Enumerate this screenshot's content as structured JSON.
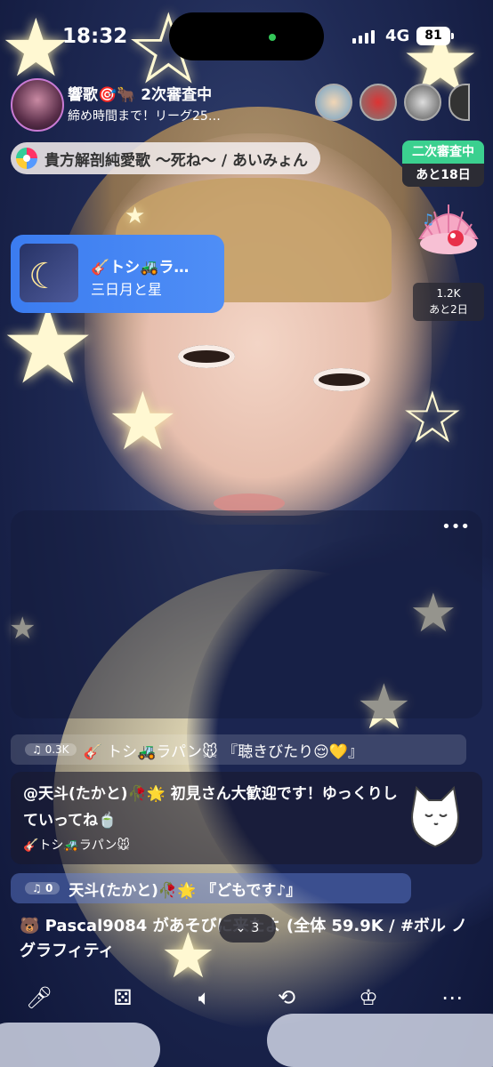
{
  "status_bar": {
    "time": "18:32",
    "network": "4G",
    "battery": "81"
  },
  "host": {
    "name": "響歌",
    "name_emoji": "🎯🐂",
    "stage": "2次審査中",
    "subtitle": "締め時間まで！リーグ25…"
  },
  "song_request": "貴方解剖純愛歌 〜死ね〜 / あいみょん",
  "review_badge": {
    "top": "二次審査中",
    "bottom": "あと18日"
  },
  "gift_event": {
    "count": "1.2K",
    "remaining": "あと2日"
  },
  "now_playing": {
    "title": "🎸トシ🚜ラ…",
    "subtitle": "三日月と星"
  },
  "chat": {
    "faded": {
      "count": "0.3K",
      "text": "🎸 トシ🚜ラパン🐭 『聴きびたり😌💛』"
    },
    "main": {
      "text": "@天斗(たかと)🥀🌟 初見さん大歓迎です！ゆっくりしていってね🍵",
      "author": "🎸トシ🚜ラパン🐭"
    },
    "reply": {
      "count": "0",
      "text": "天斗(たかと)🥀🌟 『どもです♪』"
    },
    "join": "🐻 Pascal9084 があそびに来たよ (全体 59.9K / #ボル ノグラフィティ"
  },
  "scroll_badge": {
    "count": "3"
  },
  "icons": {
    "mic": "microphone-icon",
    "dice": "dice-icon",
    "speaker": "speaker-icon",
    "camera": "camera-switch-icon",
    "crown": "crown-icon",
    "more": "more-icon"
  },
  "colors": {
    "review_green": "#3bd08f",
    "now_card_blue": "#3b7cf0"
  }
}
